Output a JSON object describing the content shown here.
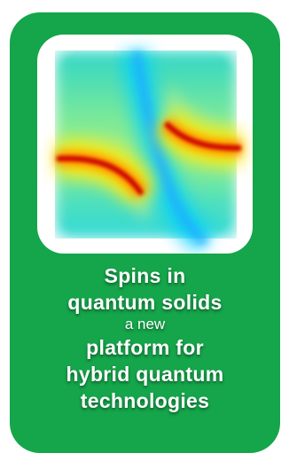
{
  "card": {
    "accent_color": "#15a54a",
    "text_color": "#ffffff"
  },
  "figure": {
    "description_icon": "avoided-crossing-heatmap-image",
    "colormap": [
      "#00ffff",
      "#7fff80",
      "#ffff00",
      "#ff8000",
      "#d00000"
    ]
  },
  "caption": {
    "line1": "Spins in",
    "line2": "quantum solids",
    "line3": "a new",
    "line4": "platform for",
    "line5": "hybrid quantum",
    "line6": "technologies"
  }
}
